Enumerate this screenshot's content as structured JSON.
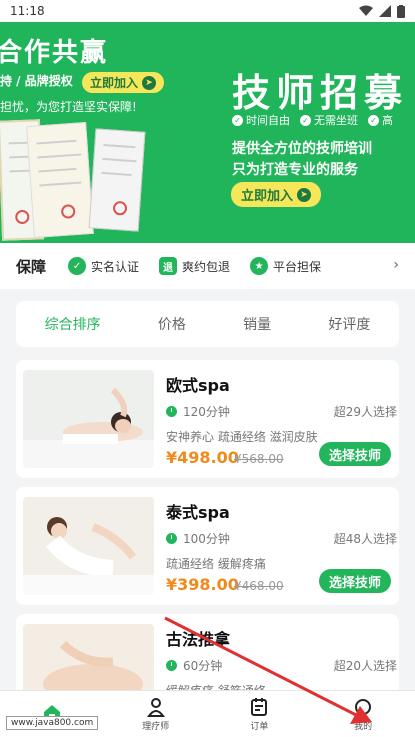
{
  "status_bar": {
    "time": "11:18"
  },
  "banner": {
    "coop_title": "合作共赢",
    "coop_sub": "持 / 品牌授权",
    "coop_join": "立即加入",
    "coop_desc": "担忧，为您打造坚实保障!",
    "recruit_title": "技师招募",
    "ticks": [
      "时间自由",
      "无需坐班",
      "高"
    ],
    "recruit_desc1": "提供全方位的技师培训",
    "recruit_desc2": "只为打造专业的服务",
    "recruit_join": "立即加入"
  },
  "guarantee": {
    "title": "保障",
    "items": [
      "实名认证",
      "爽约包退",
      "平台担保"
    ]
  },
  "sort_tabs": [
    "综合排序",
    "价格",
    "销量",
    "好评度"
  ],
  "items": [
    {
      "name": "欧式spa",
      "duration": "120分钟",
      "sold": "超29人选择",
      "tags": "安神养心 疏通经络 滋润皮肤",
      "price": "¥498.00",
      "orig": "¥568.00",
      "button": "选择技师"
    },
    {
      "name": "泰式spa",
      "duration": "100分钟",
      "sold": "超48人选择",
      "tags": "疏通经络 缓解疼痛",
      "price": "¥398.00",
      "orig": "¥468.00",
      "button": "选择技师"
    },
    {
      "name": "古法推拿",
      "duration": "60分钟",
      "sold": "超20人选择",
      "tags": "缓解疼痛 舒筋通络",
      "price": "",
      "orig": "",
      "button": ""
    }
  ],
  "tabbar": {
    "home": "",
    "therapist": "理疗师",
    "order": "订单",
    "mine": "我的"
  },
  "watermark": "www.java800.com",
  "colors": {
    "brand_green": "#22b55b",
    "banner_green": "#20b55a",
    "price_orange": "#f08a1a",
    "accent_yellow": "#f6e65a"
  }
}
